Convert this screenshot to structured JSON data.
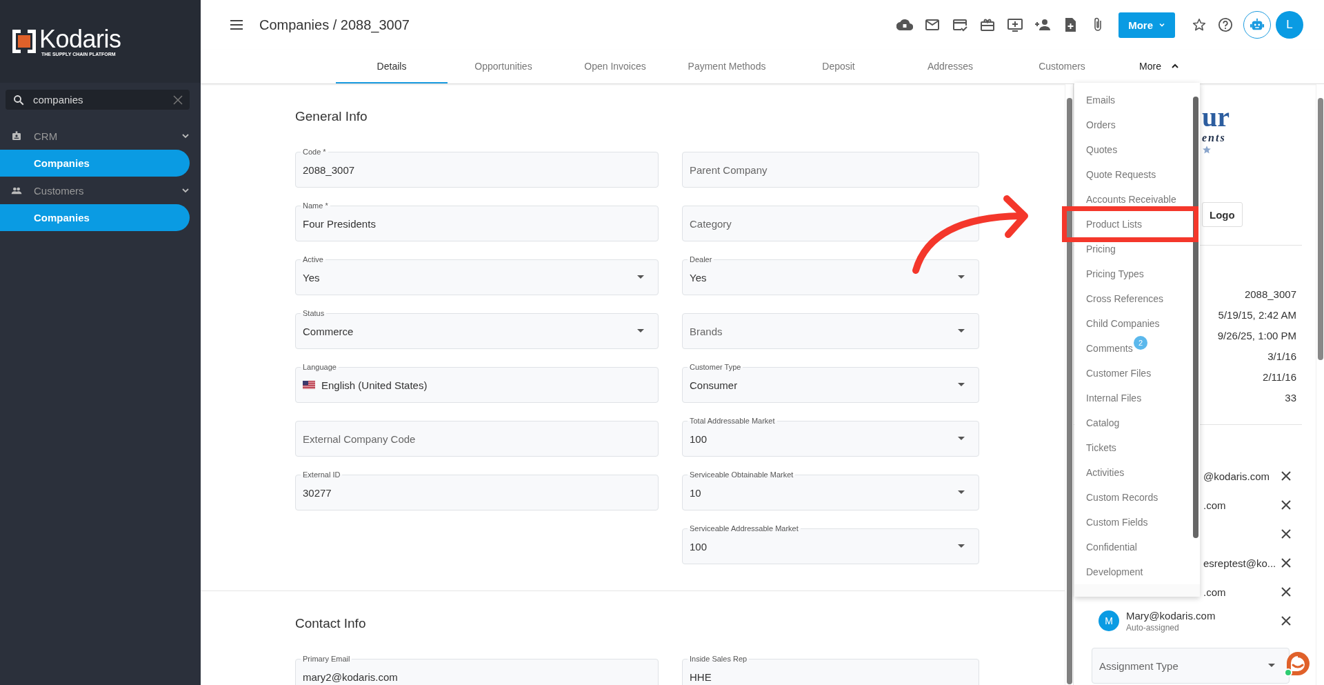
{
  "sidebar": {
    "logo": {
      "name": "Kodaris",
      "tagline": "THE SUPPLY CHAIN PLATFORM"
    },
    "search": {
      "value": "companies"
    },
    "nav": [
      {
        "label": "CRM",
        "kind": "badge",
        "expanded": true,
        "children": [
          {
            "label": "Companies",
            "selected": true
          }
        ]
      },
      {
        "label": "Customers",
        "kind": "people",
        "expanded": true,
        "children": [
          {
            "label": "Companies",
            "selected": true
          }
        ]
      }
    ]
  },
  "header": {
    "title": "Companies / 2088_3007",
    "more_button": "More",
    "avatar": "L"
  },
  "tabs": [
    {
      "label": "Details",
      "selected": true
    },
    {
      "label": "Opportunities",
      "selected": false
    },
    {
      "label": "Open Invoices",
      "selected": false
    },
    {
      "label": "Payment Methods",
      "selected": false
    },
    {
      "label": "Deposit",
      "selected": false
    },
    {
      "label": "Addresses",
      "selected": false
    },
    {
      "label": "Customers",
      "selected": false
    },
    {
      "label": "More",
      "selected": false,
      "kind": "menu",
      "expanded": true
    }
  ],
  "more_menu": [
    {
      "label": "Emails"
    },
    {
      "label": "Orders"
    },
    {
      "label": "Quotes"
    },
    {
      "label": "Quote Requests"
    },
    {
      "label": "Accounts Receivable"
    },
    {
      "label": "Product Lists"
    },
    {
      "label": "Pricing"
    },
    {
      "label": "Pricing Types"
    },
    {
      "label": "Cross References"
    },
    {
      "label": "Child Companies"
    },
    {
      "label": "Comments",
      "badge": "2"
    },
    {
      "label": "Customer Files"
    },
    {
      "label": "Internal Files"
    },
    {
      "label": "Catalog"
    },
    {
      "label": "Tickets"
    },
    {
      "label": "Activities"
    },
    {
      "label": "Custom Records"
    },
    {
      "label": "Custom Fields"
    },
    {
      "label": "Confidential"
    },
    {
      "label": "Development"
    }
  ],
  "sections": [
    {
      "title": "General Info",
      "columns": [
        [
          {
            "label": "Code *",
            "value": "2088_3007",
            "kind": "text"
          },
          {
            "label": "Name *",
            "value": "Four Presidents",
            "kind": "text"
          },
          {
            "label": "Active",
            "value": "Yes",
            "kind": "select"
          },
          {
            "label": "Status",
            "value": "Commerce",
            "kind": "select"
          },
          {
            "label": "Language",
            "value": "English (United States)",
            "kind": "locale"
          },
          {
            "placeholder": "External Company Code",
            "kind": "text"
          },
          {
            "label": "External ID",
            "value": "30277",
            "kind": "text"
          }
        ],
        [
          {
            "placeholder": "Parent Company",
            "kind": "text"
          },
          {
            "placeholder": "Category",
            "kind": "text"
          },
          {
            "label": "Dealer",
            "value": "Yes",
            "kind": "select"
          },
          {
            "placeholder": "Brands",
            "kind": "select"
          },
          {
            "label": "Customer Type",
            "value": "Consumer",
            "kind": "select"
          },
          {
            "label": "Total Addressable Market",
            "value": "100",
            "kind": "select"
          },
          {
            "label": "Serviceable Obtainable Market",
            "value": "10",
            "kind": "select"
          },
          {
            "label": "Serviceable Addressable Market",
            "value": "100",
            "kind": "select"
          }
        ]
      ]
    },
    {
      "title": "Contact Info",
      "columns": [
        [
          {
            "label": "Primary Email",
            "value": "mary2@kodaris.com",
            "kind": "text"
          }
        ],
        [
          {
            "label": "Inside Sales Rep",
            "value": "HHE",
            "kind": "text"
          }
        ]
      ]
    }
  ],
  "details_panel": {
    "logo": {
      "line_1": "ur",
      "line_2": "ents"
    },
    "logo_button": "Logo",
    "values": [
      "2088_3007",
      "5/19/15, 2:42 AM",
      "9/26/25, 1:00 PM",
      "3/1/16",
      "2/11/16",
      "33"
    ],
    "assignees": [
      {
        "kind": "covered",
        "email": "@kodaris.com"
      },
      {
        "kind": "covered",
        "email": ".com"
      },
      {
        "kind": "covered"
      },
      {
        "kind": "covered",
        "email": "esreptest@ko..."
      },
      {
        "kind": "covered",
        "email": ".com"
      },
      {
        "kind": "full",
        "initial": "M",
        "email": "Mary@kodaris.com",
        "role": "Auto-assigned"
      }
    ],
    "assignment_type": {
      "placeholder": "Assignment Type"
    }
  }
}
